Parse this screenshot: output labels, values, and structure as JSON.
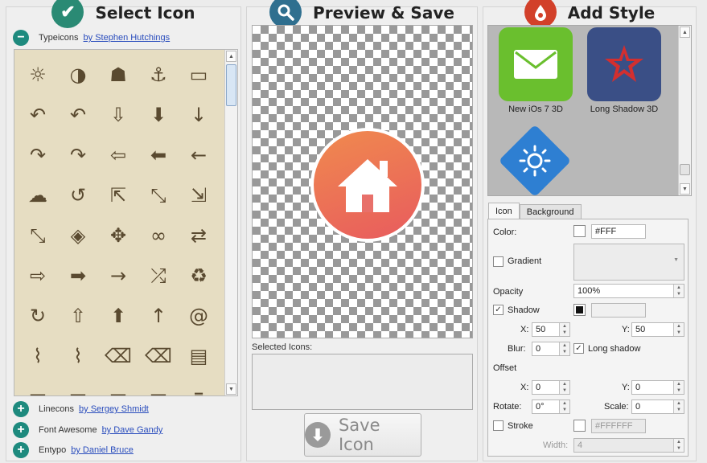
{
  "select": {
    "title": "Select Icon",
    "libraries": [
      {
        "name": "Typeicons",
        "author": "by Stephen Hutchings",
        "expanded": true
      },
      {
        "name": "Linecons",
        "author": "by Sergey Shmidt",
        "expanded": false
      },
      {
        "name": "Font Awesome",
        "author": "by Dave Gandy",
        "expanded": false
      },
      {
        "name": "Entypo",
        "author": "by Daniel Bruce",
        "expanded": false
      }
    ],
    "glyphs": [
      "☼",
      "◑",
      "☗",
      "⚓",
      "▭",
      "↶",
      "↶",
      "⇩",
      "⬇",
      "↓",
      "↷",
      "↷",
      "⇦",
      "⬅",
      "←",
      "☁",
      "↺",
      "⇱",
      "⤡",
      "⇲",
      "⤡",
      "◈",
      "✥",
      "∞",
      "⇄",
      "⇨",
      "➡",
      "→",
      "⤮",
      "♻",
      "↻",
      "⇧",
      "⬆",
      "↑",
      "@",
      "⌇",
      "⌇",
      "⌫",
      "⌫",
      "▤",
      "▬",
      "▬",
      "▬",
      "▬",
      "⌆"
    ]
  },
  "preview": {
    "title": "Preview & Save",
    "selected_label": "Selected Icons:",
    "save_label": "Save Icon"
  },
  "style": {
    "title": "Add Style",
    "styles": [
      {
        "label": "New iOs 7 3D"
      },
      {
        "label": "Long Shadow 3D"
      },
      {
        "label": ""
      }
    ],
    "tabs": [
      "Icon",
      "Background"
    ],
    "color_label": "Color:",
    "color_value": "#FFF",
    "gradient_label": "Gradient",
    "opacity_label": "Opacity",
    "opacity_value": "100%",
    "shadow_label": "Shadow",
    "shadow_checked": true,
    "x_label": "X:",
    "shadow_x": "50",
    "y_label": "Y:",
    "shadow_y": "50",
    "blur_label": "Blur:",
    "blur_value": "0",
    "long_shadow_label": "Long shadow",
    "long_shadow_checked": true,
    "offset_label": "Offset",
    "offset_x": "0",
    "offset_y": "0",
    "rotate_label": "Rotate:",
    "rotate_value": "0°",
    "scale_label": "Scale:",
    "scale_value": "0",
    "stroke_label": "Stroke",
    "stroke_color": "#FFFFFF",
    "width_label": "Width:",
    "width_value": "4"
  },
  "colors": {
    "select_icon_bg": "#2a8a74",
    "preview_icon_bg": "#2f6f8f",
    "style_icon_bg": "#d2402a",
    "grid_bg": "#e6ddc2",
    "glyph": "#5a4a30",
    "library_toggle": "#1e8a7e",
    "link": "#2a4dbd",
    "ios_green": "#6abf2e",
    "long_shadow_blue": "#3a4f86",
    "diamond_blue": "#2e7fd2",
    "preview_gradient": [
      "#f08a4e",
      "#e85b5e"
    ]
  }
}
